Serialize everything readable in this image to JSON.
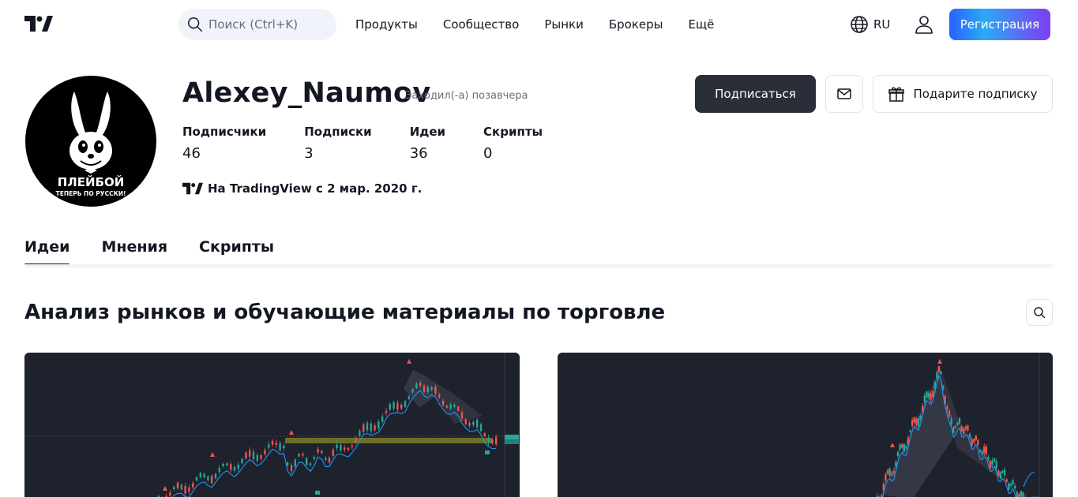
{
  "header": {
    "search_placeholder": "Поиск (Ctrl+K)",
    "nav": [
      "Продукты",
      "Сообщество",
      "Рынки",
      "Брокеры",
      "Ещё"
    ],
    "language": "RU",
    "signup_label": "Регистрация"
  },
  "profile": {
    "avatar_text_main": "ПЛЕЙБОЙ",
    "avatar_text_sub": "ТЕПЕРЬ ПО РУССКИ!",
    "username": "Alexey_Naumov",
    "last_seen": "Заходил(-а) позавчера",
    "stats": [
      {
        "label": "Подписчики",
        "value": "46"
      },
      {
        "label": "Подписки",
        "value": "3"
      },
      {
        "label": "Идеи",
        "value": "36"
      },
      {
        "label": "Скрипты",
        "value": "0"
      }
    ],
    "joined": "На TradingView с 2 мар. 2020 г."
  },
  "actions": {
    "follow_label": "Подписаться",
    "gift_label": "Подарите подписку"
  },
  "tabs": [
    "Идеи",
    "Мнения",
    "Скрипты"
  ],
  "section_title": "Анализ рынков и обучающие материалы по торговле",
  "colors": {
    "accent": "#2962ff",
    "chart_bg": "#1e222d",
    "candle_up": "#26a69a",
    "candle_down": "#ef5350",
    "ma_line": "#2196f3",
    "zone": "#8a8a2a"
  },
  "icons": [
    "tradingview-logo-icon",
    "search-icon",
    "globe-icon",
    "user-icon",
    "mail-icon",
    "gift-icon"
  ]
}
